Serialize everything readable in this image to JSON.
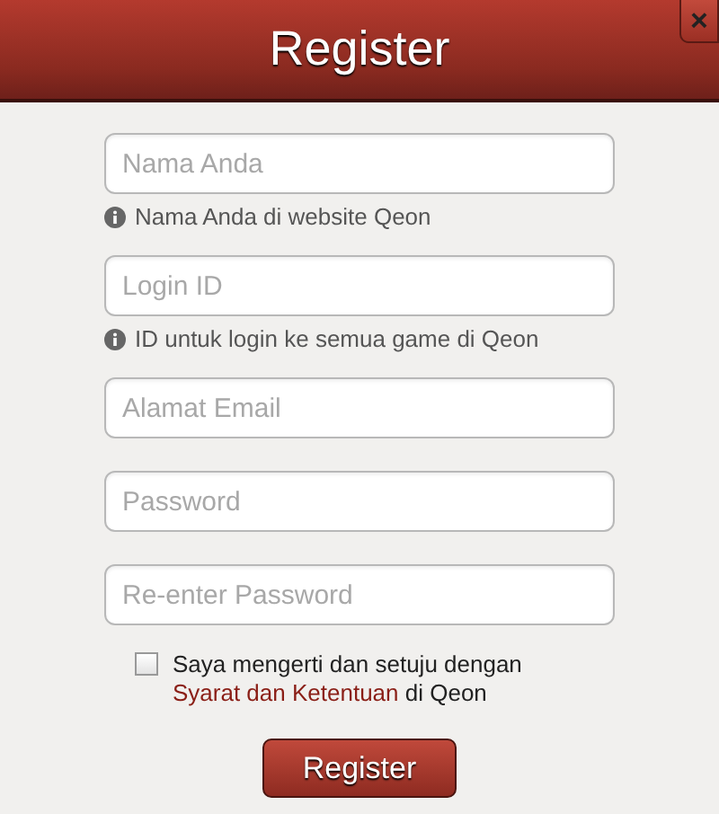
{
  "dialog": {
    "title": "Register",
    "close": "×"
  },
  "fields": [
    {
      "placeholder": "Nama Anda",
      "hint": "Nama Anda di website Qeon"
    },
    {
      "placeholder": "Login ID",
      "hint": "ID untuk login ke semua game di Qeon"
    },
    {
      "placeholder": "Alamat Email"
    },
    {
      "placeholder": "Password"
    },
    {
      "placeholder": "Re-enter Password"
    }
  ],
  "agreement": {
    "checked": false,
    "text": "Saya mengerti dan setuju dengan",
    "link": "Syarat dan Ketentuan",
    "suffix": " di Qeon"
  },
  "submit": "Register"
}
